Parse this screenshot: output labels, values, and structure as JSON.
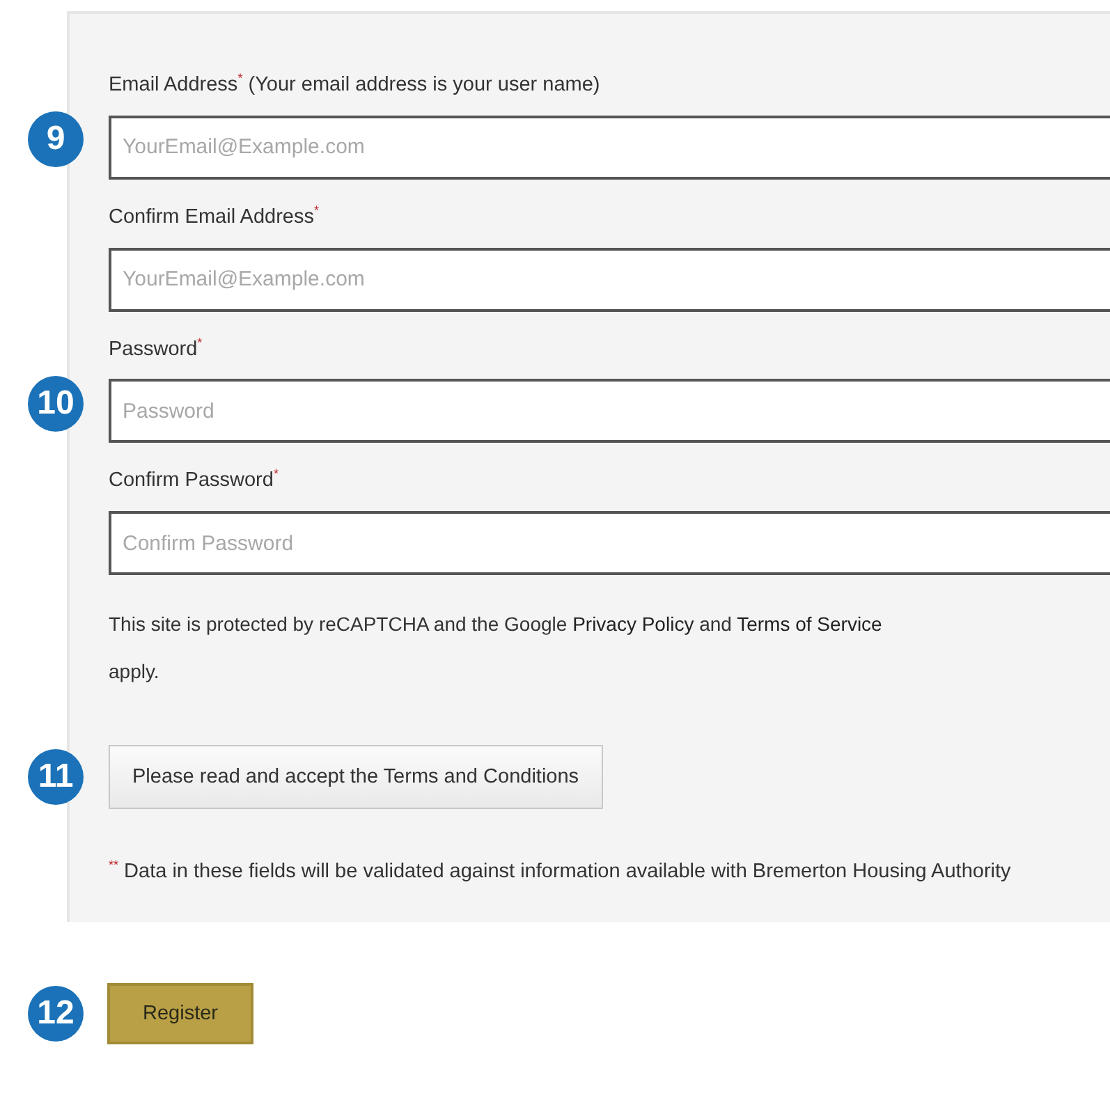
{
  "fields": [
    {
      "label": "Email Address",
      "required_mark": "*",
      "note": "(Your email address is your user name)",
      "placeholder": "YourEmail@Example.com",
      "step": "9"
    },
    {
      "label": "Confirm Email Address",
      "required_mark": "*",
      "placeholder": "YourEmail@Example.com"
    },
    {
      "label": "Password",
      "required_mark": "*",
      "placeholder": "Password",
      "step": "10"
    },
    {
      "label": "Confirm Password",
      "required_mark": "*",
      "placeholder": "Confirm Password"
    }
  ],
  "recaptcha": {
    "before": "This site is protected by reCAPTCHA and the Google",
    "privacy_link": "Privacy Policy",
    "middle": "and",
    "terms_link": "Terms of Service",
    "after": "apply."
  },
  "terms_button": {
    "label": "Please read and accept the Terms and Conditions",
    "step": "11"
  },
  "footnote": {
    "mark": "**",
    "text": "Data in these fields will be validated against information available with Bremerton Housing Authority"
  },
  "register_button": {
    "label": "Register",
    "step": "12"
  }
}
